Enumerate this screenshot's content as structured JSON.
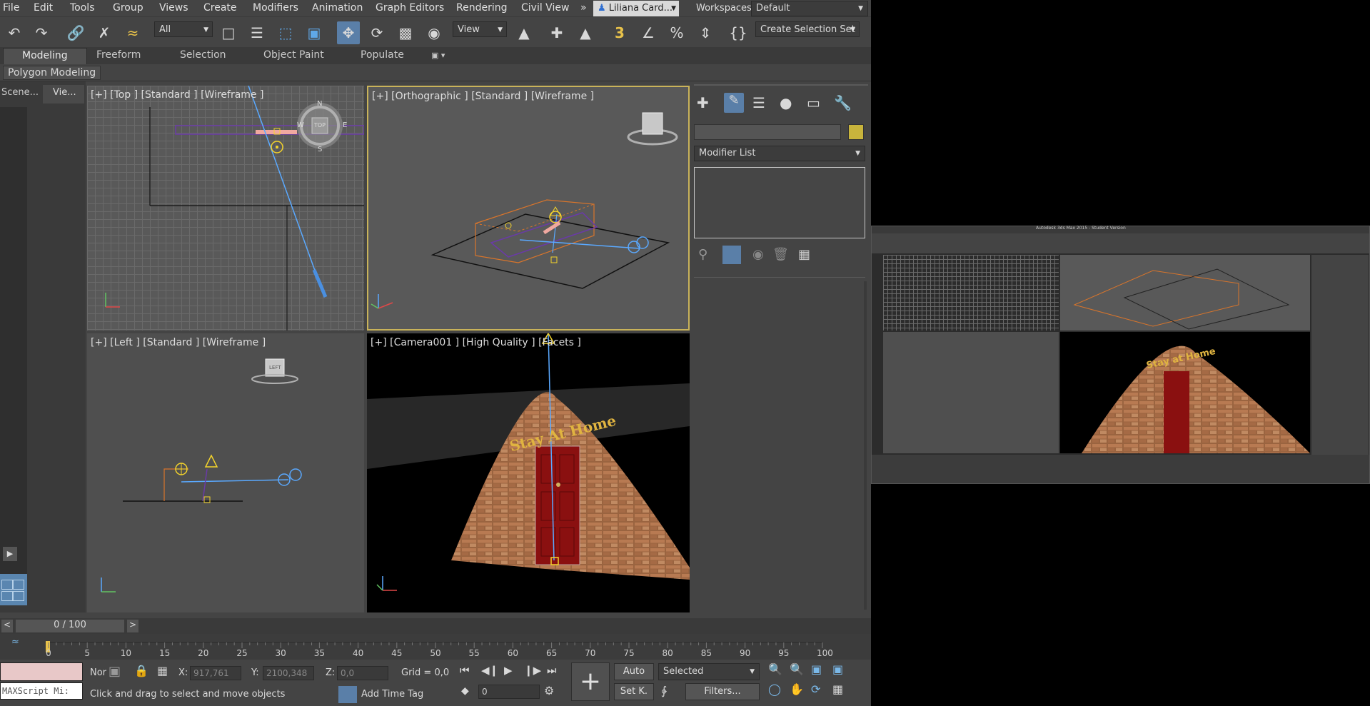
{
  "menu": {
    "items": [
      "File",
      "Edit",
      "Tools",
      "Group",
      "Views",
      "Create",
      "Modifiers",
      "Animation",
      "Graph Editors",
      "Rendering",
      "Civil View"
    ],
    "overflow": "»",
    "user": "Liliana Card...",
    "workspaces_label": "Workspaces:",
    "workspace_value": "Default"
  },
  "toolbar": {
    "selection_filter": "All",
    "reference_coord": "View",
    "spinner_snap": "3",
    "create_selection_set": "Create Selection Set"
  },
  "ribbon": {
    "tabs": [
      "Modeling",
      "Freeform",
      "Selection",
      "Object Paint",
      "Populate"
    ],
    "active_tab": "Modeling",
    "sub_label": "Polygon Modeling"
  },
  "scene_explorer": {
    "tab_scene": "Scene...",
    "tab_view": "Vie..."
  },
  "viewports": {
    "top": "[+] [Top ] [Standard ] [Wireframe ]",
    "ortho": "[+] [Orthographic ] [Standard ] [Wireframe ]",
    "left": "[+] [Left ] [Standard ] [Wireframe ]",
    "camera": "[+] [Camera001 ] [High Quality ] [Facets ]",
    "cube_top": "TOP",
    "cube_left": "LEFT",
    "compass": [
      "N",
      "E",
      "S",
      "W"
    ],
    "sign_text": "Stay At Home"
  },
  "command_panel": {
    "modifier_list": "Modifier List",
    "color_swatch": "#c8b43c"
  },
  "timeline": {
    "frame_display": "0 / 100",
    "ticks": [
      "0",
      "5",
      "10",
      "15",
      "20",
      "25",
      "30",
      "35",
      "40",
      "45",
      "50",
      "55",
      "60",
      "65",
      "70",
      "75",
      "80",
      "85",
      "90",
      "95",
      "100"
    ]
  },
  "status": {
    "maxscript": "MAXScript Mi:",
    "mode": "Nor",
    "x_label": "X:",
    "x_value": "917,761",
    "y_label": "Y:",
    "y_value": "2100,348",
    "z_label": "Z:",
    "z_value": "0,0",
    "grid": "Grid = 0,0",
    "prompt": "Click and drag to select and move objects",
    "add_time_tag": "Add Time Tag",
    "auto_key": "Auto",
    "set_key": "Set K.",
    "key_filter": "Selected",
    "filters": "Filters...",
    "frame_value": "0"
  },
  "thumbnail": {
    "title": "Autodesk 3ds Max 2015 - Student Version",
    "sign_text": "Stay at Home"
  }
}
